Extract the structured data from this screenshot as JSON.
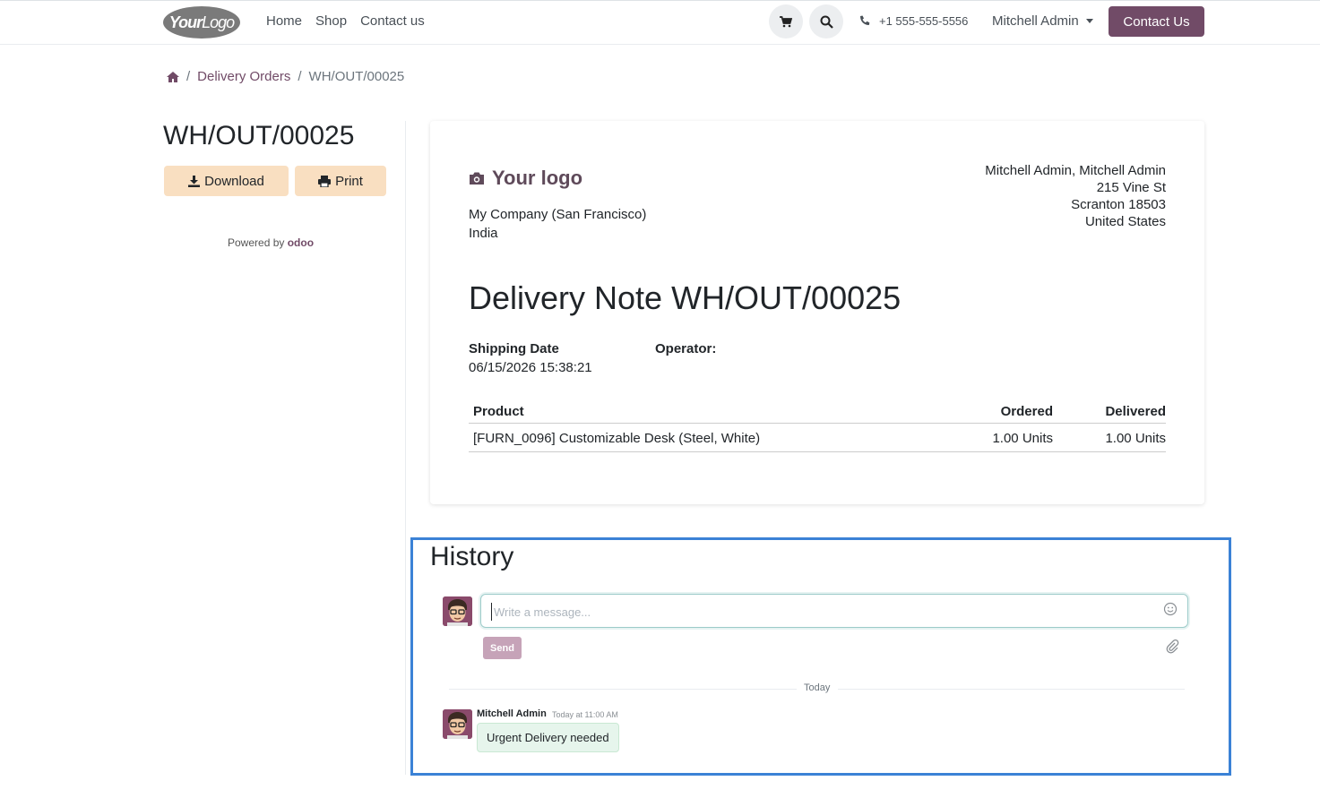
{
  "header": {
    "logo": {
      "bold": "Your",
      "light": "Logo"
    },
    "nav": [
      "Home",
      "Shop",
      "Contact us"
    ],
    "phone": "+1 555-555-5556",
    "user": "Mitchell Admin",
    "contact_button": "Contact Us"
  },
  "breadcrumb": {
    "items": [
      "Delivery Orders",
      "WH/OUT/00025"
    ]
  },
  "sidebar": {
    "title": "WH/OUT/00025",
    "download_label": "Download",
    "print_label": "Print",
    "powered_by": "Powered by",
    "powered_brand": "odoo"
  },
  "document": {
    "logo_text": "Your logo",
    "company_name": "My Company (San Francisco)",
    "company_country": "India",
    "address": [
      "Mitchell Admin, Mitchell Admin",
      "215 Vine St",
      "Scranton 18503",
      "United States"
    ],
    "title": "Delivery Note WH/OUT/00025",
    "shipping_date_label": "Shipping Date",
    "shipping_date_value": "06/15/2026 15:38:21",
    "operator_label": "Operator:",
    "table": {
      "headers": [
        "Product",
        "Ordered",
        "Delivered"
      ],
      "rows": [
        [
          "[FURN_0096] Customizable Desk (Steel, White)",
          "1.00 Units",
          "1.00 Units"
        ]
      ]
    }
  },
  "history": {
    "title": "History",
    "input_placeholder": "Write a message...",
    "send_label": "Send",
    "day_label": "Today",
    "messages": [
      {
        "author": "Mitchell Admin",
        "date": "Today at 11:00 AM",
        "body": "Urgent Delivery needed"
      }
    ]
  },
  "colors": {
    "brand": "#714b67",
    "soft_button": "#f9dfc1",
    "highlight_border": "#3b82d6"
  },
  "icons": [
    "home-icon",
    "cart-icon",
    "search-icon",
    "phone-icon",
    "download-icon",
    "print-icon",
    "camera-icon",
    "emoji-icon",
    "paperclip-icon"
  ]
}
